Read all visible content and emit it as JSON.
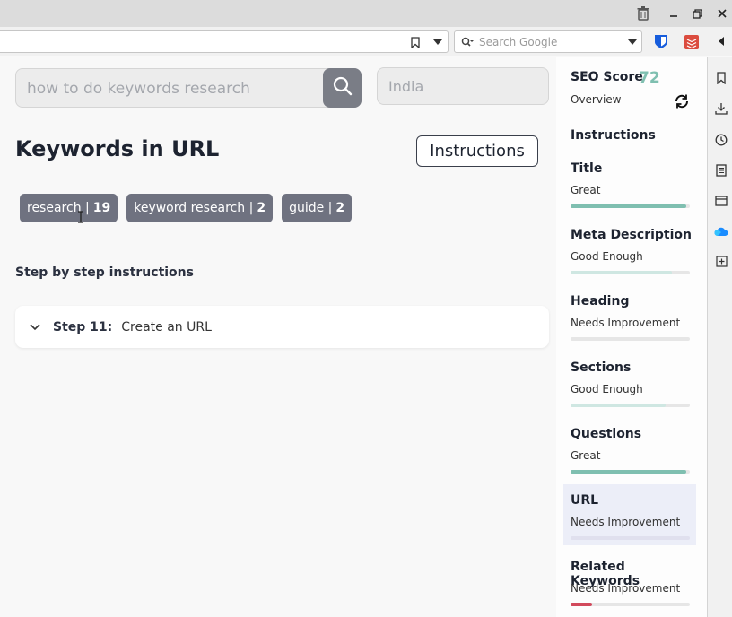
{
  "browser": {
    "search_placeholder": "Search Google",
    "icons": [
      "trash-icon",
      "minimize-icon",
      "restore-icon",
      "close-icon",
      "bookmark-icon",
      "dropdown-icon",
      "search-icon",
      "bitwarden-icon",
      "todoist-icon",
      "sidebar-toggle-icon"
    ]
  },
  "main": {
    "keyword_placeholder": "how to do keywords research",
    "country_placeholder": "India",
    "heading": "Keywords in URL",
    "instructions_button": "Instructions",
    "chips": [
      {
        "label": "research |",
        "count": "19"
      },
      {
        "label": "keyword research |",
        "count": "2"
      },
      {
        "label": "guide |",
        "count": "2"
      }
    ],
    "steps_title": "Step by step instructions",
    "step": {
      "number": "Step 11:",
      "text": "Create an URL"
    }
  },
  "panel": {
    "seo_label": "SEO Score",
    "seo_score": "72",
    "overview": "Overview",
    "instructions": "Instructions",
    "metrics": [
      {
        "name": "Title",
        "status": "Great",
        "progress": 0.97,
        "color": "#7fbfb0"
      },
      {
        "name": "Meta Description",
        "status": "Good Enough",
        "progress": 0.85,
        "color": "#cfe7e2"
      },
      {
        "name": "Heading",
        "status": "Needs Improvement",
        "progress": 0.0,
        "color": "#e6e6e6"
      },
      {
        "name": "Sections",
        "status": "Good Enough",
        "progress": 0.8,
        "color": "#cfe7e2"
      },
      {
        "name": "Questions",
        "status": "Great",
        "progress": 0.97,
        "color": "#7fbfb0"
      },
      {
        "name": "URL",
        "status": "Needs Improvement",
        "progress": 0.0,
        "color": "#e0e0ee"
      },
      {
        "name": "Related Keywords",
        "status": "Needs Improvement",
        "progress": 0.18,
        "color": "#d24a5c"
      }
    ]
  },
  "colors": {
    "accent": "#7fbfb0",
    "chip": "#6f7280",
    "danger": "#d24a5c"
  }
}
